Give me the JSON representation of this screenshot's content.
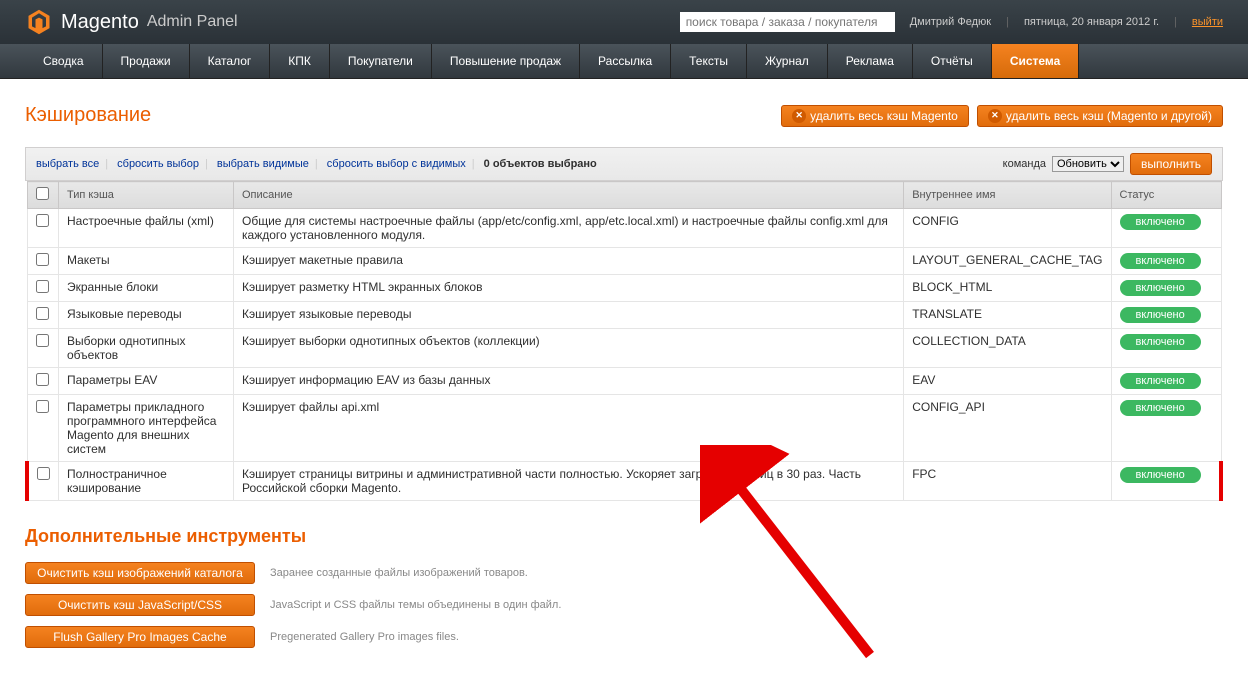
{
  "header": {
    "logo": "Magento",
    "admin": "Admin Panel",
    "search_placeholder": "поиск товара / заказа / покупателя",
    "user": "Дмитрий Федюк",
    "date": "пятница, 20 января 2012 г.",
    "logout": "выйти"
  },
  "nav": [
    "Сводка",
    "Продажи",
    "Каталог",
    "КПК",
    "Покупатели",
    "Повышение продаж",
    "Рассылка",
    "Тексты",
    "Журнал",
    "Реклама",
    "Отчёты",
    "Система"
  ],
  "nav_active": 11,
  "page": {
    "title": "Кэширование",
    "btn_flush_magento": "удалить весь кэш Magento",
    "btn_flush_all": "удалить весь кэш (Magento и другой)"
  },
  "toolbar": {
    "select_all": "выбрать все",
    "reset_selection": "сбросить выбор",
    "select_visible": "выбрать видимые",
    "reset_visible": "сбросить выбор с видимых",
    "selected_count": "0 объектов выбрано",
    "action_label": "команда",
    "action_options": [
      "Обновить"
    ],
    "submit": "выполнить"
  },
  "columns": {
    "type": "Тип кэша",
    "desc": "Описание",
    "tag": "Внутреннее имя",
    "status": "Статус"
  },
  "rows": [
    {
      "type": "Настроечные файлы (xml)",
      "desc": "Общие для системы настроечные файлы (app/etc/config.xml, app/etc.local.xml) и настроечные файлы config.xml для каждого установленного модуля.",
      "tag": "CONFIG",
      "status": "включено"
    },
    {
      "type": "Макеты",
      "desc": "Кэширует макетные правила",
      "tag": "LAYOUT_GENERAL_CACHE_TAG",
      "status": "включено"
    },
    {
      "type": "Экранные блоки",
      "desc": "Кэширует разметку HTML экранных блоков",
      "tag": "BLOCK_HTML",
      "status": "включено"
    },
    {
      "type": "Языковые переводы",
      "desc": "Кэширует языковые переводы",
      "tag": "TRANSLATE",
      "status": "включено"
    },
    {
      "type": "Выборки однотипных объектов",
      "desc": "Кэширует выборки однотипных объектов (коллекции)",
      "tag": "COLLECTION_DATA",
      "status": "включено"
    },
    {
      "type": "Параметры EAV",
      "desc": "Кэширует информацию EAV из базы данных",
      "tag": "EAV",
      "status": "включено"
    },
    {
      "type": "Параметры прикладного программного интерфейса Magento для внешних систем",
      "desc": "Кэширует файлы api.xml",
      "tag": "CONFIG_API",
      "status": "включено"
    },
    {
      "type": "Полностраничное кэширование",
      "desc": "Кэширует страницы витрины и административной части полностью. Ускоряет загрузку страниц в 30 раз. Часть Российской сборки Magento.",
      "tag": "FPC",
      "status": "включено",
      "highlight": true
    }
  ],
  "tools": {
    "title": "Дополнительные инструменты",
    "items": [
      {
        "btn": "Очистить кэш изображений каталога",
        "desc": "Заранее созданные файлы изображений товаров."
      },
      {
        "btn": "Очистить кэш JavaScript/CSS",
        "desc": "JavaScript и CSS файлы темы объединены в один файл."
      },
      {
        "btn": "Flush Gallery Pro Images Cache",
        "desc": "Pregenerated Gallery Pro images files."
      }
    ]
  }
}
